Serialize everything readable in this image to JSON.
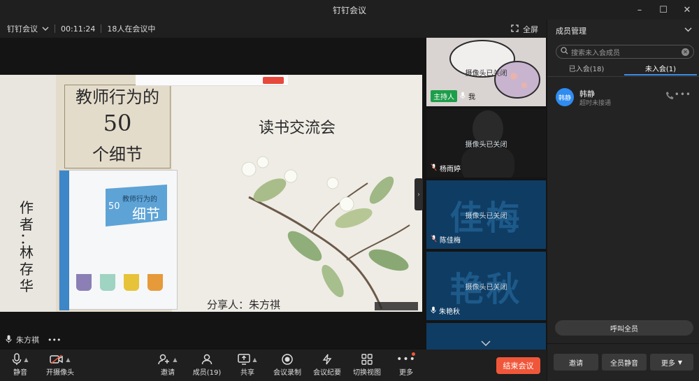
{
  "window": {
    "title": "钉钉会议",
    "minimize": "–",
    "maximize": "☐",
    "close": "✕"
  },
  "infobar": {
    "meeting_name": "钉钉会议",
    "elapsed": "00:11:24",
    "participants_text": "18人在会议中",
    "fullscreen_label": "全屏"
  },
  "slide": {
    "book_title_line1": "教师行为的",
    "book_title_line2": "50",
    "book_title_line3": "个细节",
    "event_title": "读书交流会",
    "author_chars": [
      "作",
      "者",
      "：",
      "林",
      "存",
      "华"
    ],
    "presenter": "分享人：朱方祺",
    "cover_title": "教师行为的",
    "cover_num": "50",
    "cover_sub": "细节"
  },
  "speaker": {
    "name": "朱方祺",
    "more": "•••"
  },
  "videos": [
    {
      "status": "摄像头已关闭",
      "badge": "主持人",
      "name": "我",
      "bigname": "",
      "bg": "#d9d4d2"
    },
    {
      "status": "摄像头已关闭",
      "badge": "",
      "name": "杨雨婷",
      "bigname": "",
      "bg": "#181818"
    },
    {
      "status": "摄像头已关闭",
      "badge": "",
      "name": "陈佳梅",
      "bigname": "佳梅",
      "bg": "#0f3c63"
    },
    {
      "status": "",
      "badge": "",
      "name": "朱艳秋",
      "bigname": "艳秋",
      "bg": "#0f3c63",
      "overlay": "摄像头已关闭"
    }
  ],
  "toolbar": {
    "mute": "静音",
    "camera": "开摄像头",
    "invite": "邀请",
    "members": "成员(19)",
    "share": "共享",
    "record": "会议录制",
    "minutes": "会议纪要",
    "layout": "切换视图",
    "more": "更多",
    "end": "结束会议"
  },
  "panel": {
    "title": "成员管理",
    "search_placeholder": "搜索未入会成员",
    "tab_joined": "已入会(18)",
    "tab_not_joined": "未入会(1)",
    "member": {
      "avatar_text": "韩静",
      "name": "韩静",
      "status": "超时未接通"
    },
    "call_all": "呼叫全员",
    "invite": "邀请",
    "mute_all": "全员静音",
    "more": "更多"
  },
  "colors": {
    "accent": "#3a8ee6",
    "end": "#f0573a",
    "host": "#1d9e4a",
    "avatar": "#2f8cf0"
  }
}
